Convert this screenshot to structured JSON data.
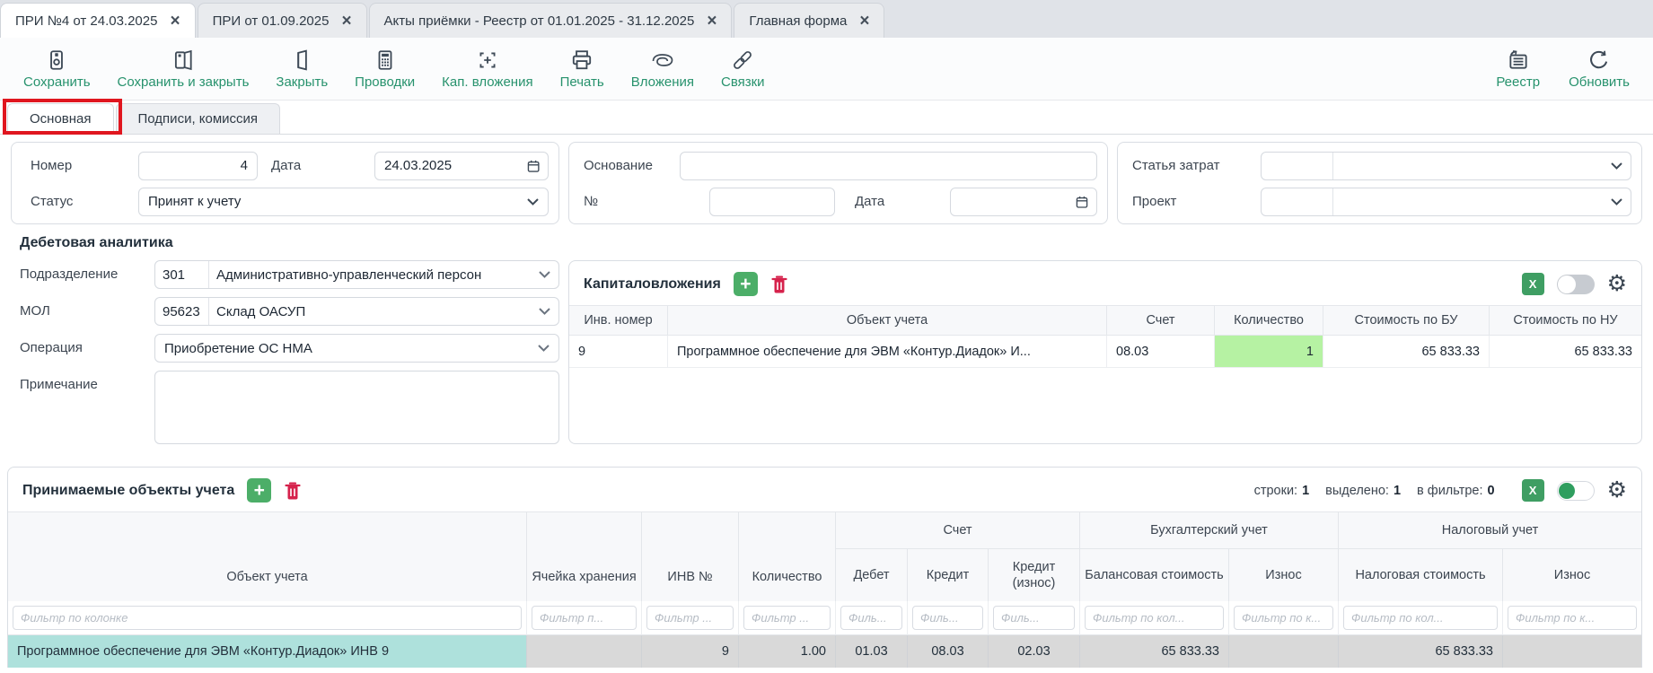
{
  "icons": {
    "close": "×",
    "plus": "+",
    "excel": "X",
    "gear": "⚙"
  },
  "colors": {
    "accent_green": "#27926d",
    "button_green": "#4cae68",
    "excel_green": "#3f9e63",
    "danger_red": "#d6224c",
    "annotation_red": "#e0161f",
    "selected_teal": "#aee1dc",
    "qty_green": "#b6f2a3",
    "row_gray": "#d9d9d9",
    "toggle_on_green": "#2f9e5f"
  },
  "tabs": [
    {
      "label": "ПРИ №4 от 24.03.2025",
      "active": true
    },
    {
      "label": "ПРИ от 01.09.2025",
      "active": false
    },
    {
      "label": "Акты приёмки - Реестр от 01.01.2025 - 31.12.2025",
      "active": false
    },
    {
      "label": "Главная форма",
      "active": false
    }
  ],
  "toolbar": {
    "items": [
      {
        "label": "Сохранить"
      },
      {
        "label": "Сохранить и закрыть"
      },
      {
        "label": "Закрыть"
      },
      {
        "label": "Проводки"
      },
      {
        "label": "Кап. вложения"
      },
      {
        "label": "Печать"
      },
      {
        "label": "Вложения"
      },
      {
        "label": "Связки"
      }
    ],
    "right": [
      {
        "label": "Реестр"
      },
      {
        "label": "Обновить"
      }
    ]
  },
  "subtabs": [
    {
      "label": "Основная",
      "active": true
    },
    {
      "label": "Подписи, комиссия",
      "active": false
    }
  ],
  "form": {
    "nomer_label": "Номер",
    "nomer_value": "4",
    "data_label": "Дата",
    "data_value": "24.03.2025",
    "status_label": "Статус",
    "status_value": "Принят к учету",
    "osnovanie_label": "Основание",
    "osnovanie_value": "",
    "num_label": "№",
    "num_value": "",
    "data2_label": "Дата",
    "data2_value": "",
    "statya_label": "Статья затрат",
    "statya_code": "",
    "statya_value": "",
    "proekt_label": "Проект",
    "proekt_code": "",
    "proekt_value": ""
  },
  "debit": {
    "title": "Дебетовая аналитика",
    "podrazdelenie_label": "Подразделение",
    "podrazdelenie_code": "301",
    "podrazdelenie_value": "Административно-управленческий персон",
    "mol_label": "МОЛ",
    "mol_code": "95623",
    "mol_value": "Склад ОАСУП",
    "operaciya_label": "Операция",
    "operaciya_value": "Приобретение ОС НМА",
    "primechanie_label": "Примечание",
    "primechanie_value": ""
  },
  "capital": {
    "title": "Капиталовложения",
    "columns": [
      "Инв. номер",
      "Объект учета",
      "Счет",
      "Количество",
      "Стоимость по БУ",
      "Стоимость по НУ"
    ],
    "row": {
      "inv": "9",
      "object": "Программное обеспечение для ЭВМ «Контур.Диадок» И...",
      "account": "08.03",
      "qty": "1",
      "cost_bu": "65 833.33",
      "cost_nu": "65 833.33"
    }
  },
  "accepted": {
    "title": "Принимаемые объекты учета",
    "counters": {
      "rows_label": "строки:",
      "rows": "1",
      "selected_label": "выделено:",
      "selected": "1",
      "filtered_label": "в фильтре:",
      "filtered": "0"
    },
    "groups": {
      "schet": "Счет",
      "bu": "Бухгалтерский учет",
      "nu": "Налоговый учет"
    },
    "columns": {
      "object": "Объект учета",
      "cell": "Ячейка хранения",
      "inv": "ИНВ №",
      "qty": "Количество",
      "debit": "Дебет",
      "credit": "Кредит",
      "credit_iznos": "Кредит (износ)",
      "balance": "Балансовая стоимость",
      "iznos_bu": "Износ",
      "tax": "Налоговая стоимость",
      "iznos_nu": "Износ"
    },
    "filters": {
      "object": "Фильтр по колонке",
      "cell": "Фильтр п...",
      "inv": "Фильтр ...",
      "qty": "Фильтр ...",
      "debit": "Филь...",
      "credit": "Филь...",
      "credit_iznos": "Филь...",
      "balance": "Фильтр по кол...",
      "iznos_bu": "Фильтр по к...",
      "tax": "Фильтр по кол...",
      "iznos_nu": "Фильтр по к..."
    },
    "row": {
      "object": "Программное обеспечение для ЭВМ «Контур.Диадок» ИНВ 9",
      "cell": "",
      "inv": "9",
      "qty": "1.00",
      "debit": "01.03",
      "credit": "08.03",
      "credit_iznos": "02.03",
      "balance": "65 833.33",
      "iznos_bu": "",
      "tax": "65 833.33",
      "iznos_nu": ""
    }
  }
}
